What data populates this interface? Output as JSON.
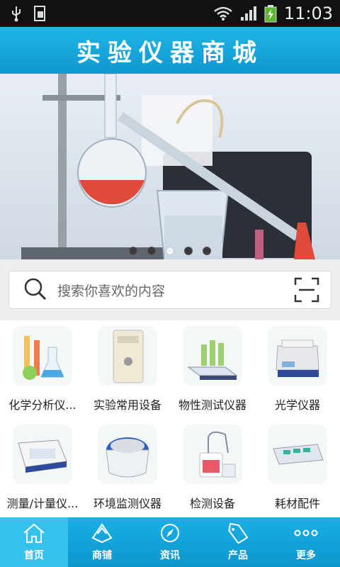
{
  "statusbar": {
    "time": "11:03"
  },
  "header": {
    "title": "实验仪器商城"
  },
  "banner": {
    "slide_count": 5,
    "active_index": 2
  },
  "search": {
    "placeholder": "搜索你喜欢的内容"
  },
  "categories": [
    {
      "label": "化学分析仪...",
      "icon": "flasks-icon"
    },
    {
      "label": "实验常用设备",
      "icon": "water-purifier-icon"
    },
    {
      "label": "物性测试仪器",
      "icon": "shaker-icon"
    },
    {
      "label": "光学仪器",
      "icon": "pcr-machine-icon"
    },
    {
      "label": "测量/计量仪...",
      "icon": "electrophoresis-icon"
    },
    {
      "label": "环境监测仪器",
      "icon": "centrifuge-icon"
    },
    {
      "label": "检测设备",
      "icon": "vacuum-pump-icon"
    },
    {
      "label": "耗材配件",
      "icon": "gel-tray-icon"
    }
  ],
  "tabs": [
    {
      "label": "首页",
      "icon": "home-icon",
      "active": true
    },
    {
      "label": "商铺",
      "icon": "store-icon",
      "active": false
    },
    {
      "label": "资讯",
      "icon": "compass-icon",
      "active": false
    },
    {
      "label": "产品",
      "icon": "tag-icon",
      "active": false
    },
    {
      "label": "更多",
      "icon": "more-icon",
      "active": false
    }
  ]
}
